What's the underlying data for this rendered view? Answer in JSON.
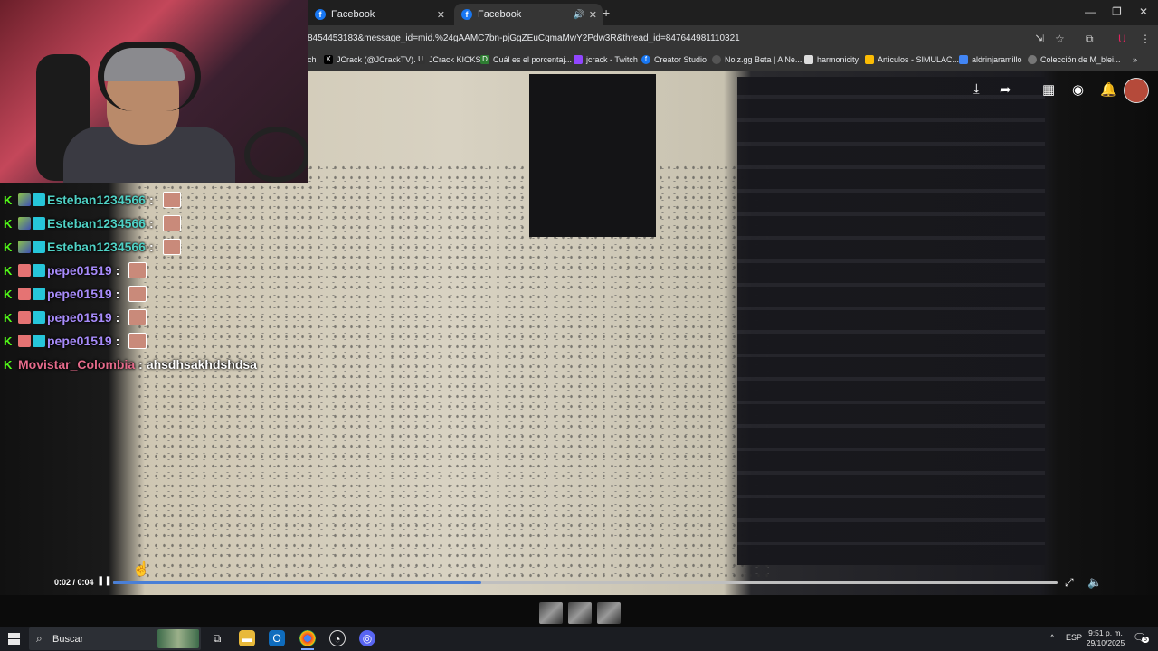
{
  "browser": {
    "tabs": [
      {
        "label": "Facebook",
        "active": false
      },
      {
        "label": "Facebook",
        "active": true
      }
    ],
    "url": "8454453183&message_id=mid.%24gAAMC7bn-pjGgZEuCqmaMwY2Pdw3R&thread_id=847644981110321",
    "bookmarks": [
      "ch",
      "JCrack (@JCrackTV)...",
      "JCrack KICKS",
      "Cuál es el porcentaj...",
      "jcrack - Twitch",
      "Creator Studio",
      "Noiz.gg Beta | A Ne...",
      "harmonicity",
      "Articulos - SIMULAC...",
      "aldrinjaramillo",
      "Colección de M_blei..."
    ]
  },
  "chat": [
    {
      "user": "Esteban1234566",
      "color": "#4fd1c5",
      "message": ""
    },
    {
      "user": "Esteban1234566",
      "color": "#4fd1c5",
      "message": ""
    },
    {
      "user": "Esteban1234566",
      "color": "#4fd1c5",
      "message": ""
    },
    {
      "user": "pepe01519",
      "color": "#a78bfa",
      "message": ""
    },
    {
      "user": "pepe01519",
      "color": "#a78bfa",
      "message": ""
    },
    {
      "user": "pepe01519",
      "color": "#a78bfa",
      "message": ""
    },
    {
      "user": "pepe01519",
      "color": "#a78bfa",
      "message": ""
    },
    {
      "user": "Movistar_Colombia",
      "color": "#e56a8a",
      "message": "ahsdhsakhdshdsa"
    }
  ],
  "chat_separator": ":",
  "video": {
    "time": "0:02 / 0:04",
    "progress_fraction": 0.39
  },
  "taskbar": {
    "search_placeholder": "Buscar",
    "language": "ESP",
    "time": "9:51 p. m.",
    "date": "29/10/2025",
    "notification_count": "5"
  },
  "icons": {
    "badge": "kick-badge-icon",
    "accent": "#53fc18"
  }
}
